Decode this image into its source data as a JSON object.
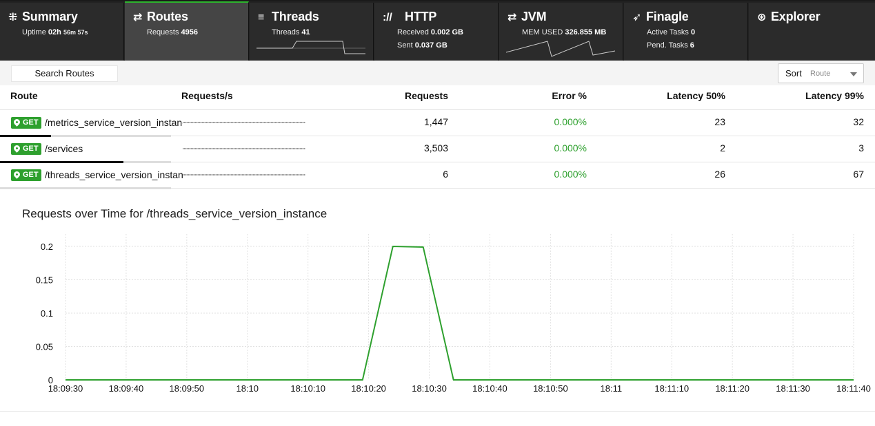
{
  "nav": {
    "summary": {
      "title": "Summary",
      "uptime_label": "Uptime",
      "uptime_h": "02h",
      "uptime_ms": "56m 57s"
    },
    "routes": {
      "title": "Routes",
      "requests_label": "Requests",
      "requests_value": "4956"
    },
    "threads": {
      "title": "Threads",
      "threads_label": "Threads",
      "threads_value": "41"
    },
    "http": {
      "title": "HTTP",
      "received_label": "Received",
      "received_value": "0.002 GB",
      "sent_label": "Sent",
      "sent_value": "0.037 GB"
    },
    "jvm": {
      "title": "JVM",
      "mem_label": "MEM USED",
      "mem_value": "326.855 MB"
    },
    "finagle": {
      "title": "Finagle",
      "active_label": "Active Tasks",
      "active_value": "0",
      "pend_label": "Pend. Tasks",
      "pend_value": "6"
    },
    "explorer": {
      "title": "Explorer"
    }
  },
  "toolbar": {
    "search_label": "Search Routes",
    "sort_label": "Sort",
    "sort_value": "Route"
  },
  "table": {
    "headers": {
      "route": "Route",
      "rps": "Requests/s",
      "requests": "Requests",
      "error": "Error %",
      "p50": "Latency 50%",
      "p99": "Latency 99%"
    },
    "rows": [
      {
        "method": "GET",
        "path": "/metrics_service_version_instance",
        "requests": "1,447",
        "error": "0.000%",
        "p50": "23",
        "p99": "32",
        "share": 0.3
      },
      {
        "method": "GET",
        "path": "/services",
        "requests": "3,503",
        "error": "0.000%",
        "p50": "2",
        "p99": "3",
        "share": 0.72
      },
      {
        "method": "GET",
        "path": "/threads_service_version_instance",
        "requests": "6",
        "error": "0.000%",
        "p50": "26",
        "p99": "67",
        "share": 0.0
      }
    ]
  },
  "chart_title": "Requests over Time for /threads_service_version_instance",
  "colors": {
    "accent": "#2db52d",
    "line": "#2ea02e",
    "nav_bg": "#222222"
  },
  "chart_data": {
    "type": "line",
    "title": "Requests over Time for /threads_service_version_instance",
    "xlabel": "",
    "ylabel": "",
    "x_ticks": [
      "18:09:30",
      "18:09:40",
      "18:09:50",
      "18:10",
      "18:10:10",
      "18:10:20",
      "18:10:30",
      "18:10:40",
      "18:10:50",
      "18:11",
      "18:11:10",
      "18:11:20",
      "18:11:30",
      "18:11:40"
    ],
    "y_ticks": [
      "0",
      "0.05",
      "0.1",
      "0.15",
      "0.2"
    ],
    "ylim": [
      0,
      0.2
    ],
    "xlim": [
      "18:09:30",
      "18:11:40"
    ],
    "grid": true,
    "series": [
      {
        "x": [
          "18:09:30",
          "18:10:19",
          "18:10:24",
          "18:10:29",
          "18:10:34",
          "18:11:40"
        ],
        "y": [
          0,
          0,
          0.2,
          0.199,
          0,
          0
        ]
      }
    ]
  }
}
